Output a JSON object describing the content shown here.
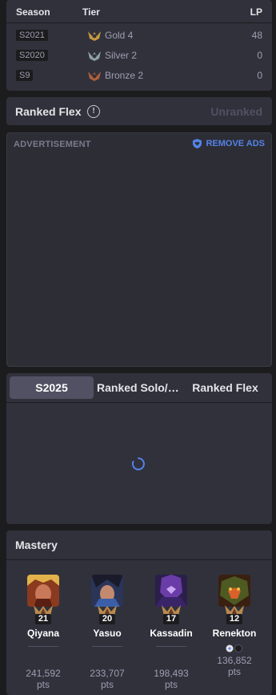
{
  "history": {
    "headers": {
      "season": "Season",
      "tier": "Tier",
      "lp": "LP"
    },
    "rows": [
      {
        "season": "S2021",
        "tier": "Gold 4",
        "lp": "48",
        "color": "#c89b3c"
      },
      {
        "season": "S2020",
        "tier": "Silver 2",
        "lp": "0",
        "color": "#8ea2a6"
      },
      {
        "season": "S9",
        "tier": "Bronze 2",
        "lp": "0",
        "color": "#b0603a"
      }
    ]
  },
  "flex": {
    "title": "Ranked Flex",
    "status": "Unranked"
  },
  "ad": {
    "label": "ADVERTISEMENT",
    "remove_label": "REMOVE ADS"
  },
  "stats": {
    "tabs": [
      "S2025",
      "Ranked Solo/D…",
      "Ranked Flex"
    ]
  },
  "mastery": {
    "title": "Mastery",
    "champions": [
      {
        "name": "Qiyana",
        "level": "21",
        "points": "241,592",
        "unit": "pts",
        "portrait": "qiyana-portrait"
      },
      {
        "name": "Yasuo",
        "level": "20",
        "points": "233,707",
        "unit": "pts",
        "portrait": "yasuo-portrait"
      },
      {
        "name": "Kassadin",
        "level": "17",
        "points": "198,493",
        "unit": "pts",
        "portrait": "kassadin-portrait"
      },
      {
        "name": "Renekton",
        "level": "12",
        "points": "136,852",
        "unit": "pts",
        "portrait": "renekton-portrait"
      }
    ]
  },
  "colors": {
    "accent": "#5383e8",
    "card": "#31313c",
    "background": "#1c1c1f"
  }
}
